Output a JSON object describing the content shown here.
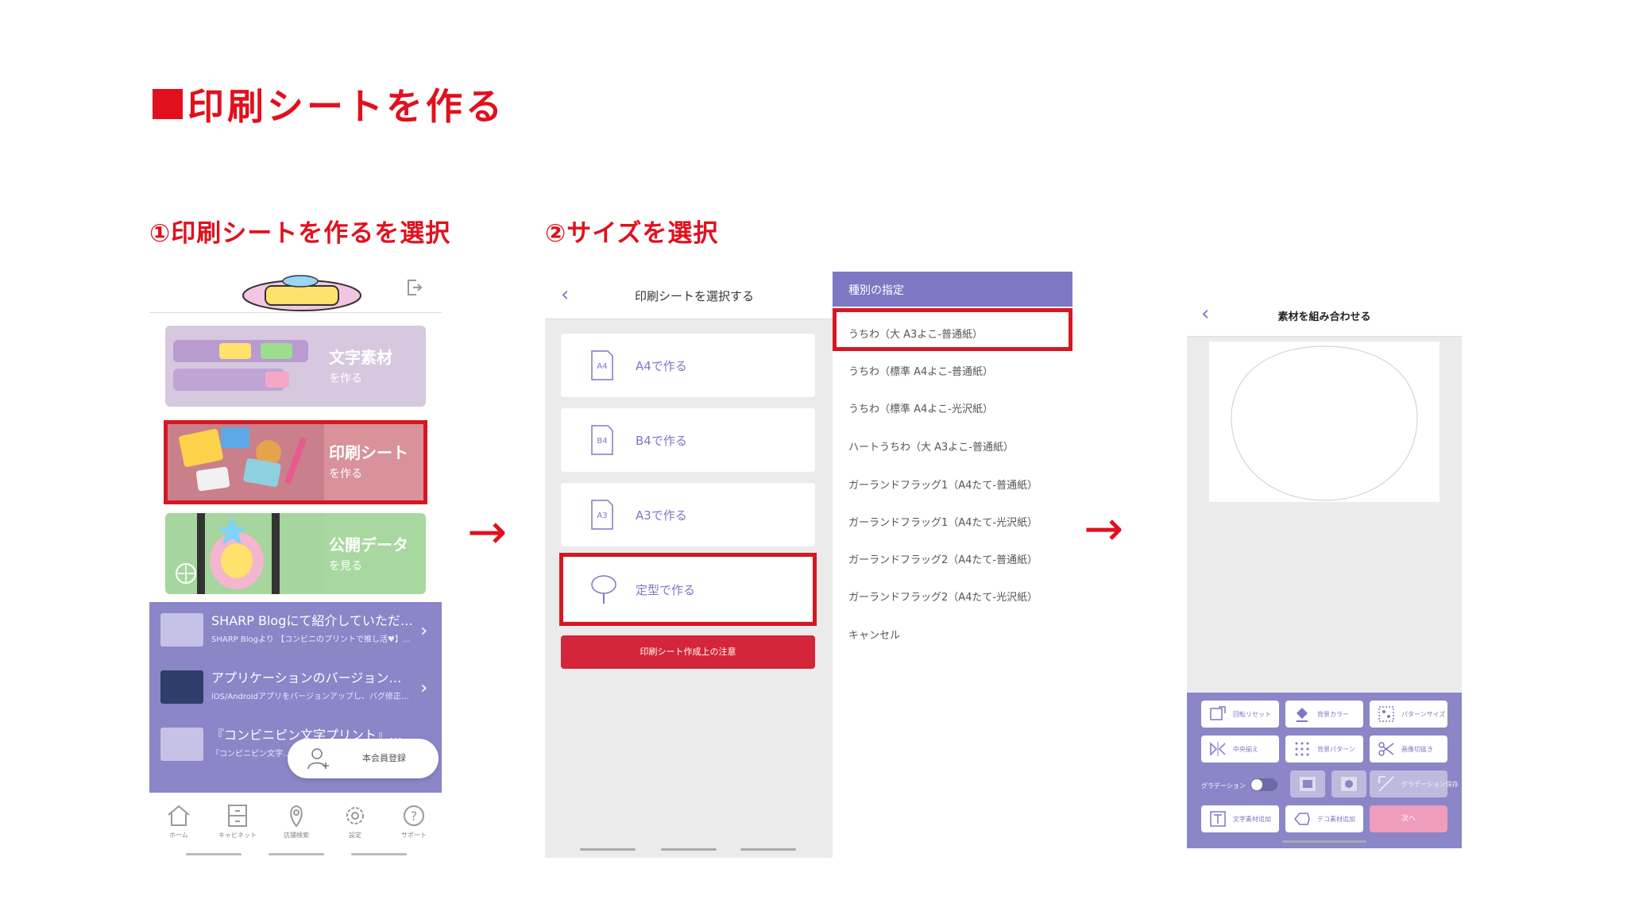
{
  "heading": "印刷シートを作る",
  "step1": "①印刷シートを作るを選択",
  "step2": "②サイズを選択",
  "arrow": "→",
  "screen1": {
    "cards": [
      {
        "title": "文字素材",
        "sub": "を作る"
      },
      {
        "title": "印刷シート",
        "sub": "を作る"
      },
      {
        "title": "公開データ",
        "sub": "を見る"
      }
    ],
    "news": [
      {
        "title": "SHARP Blogにて紹介していただ…",
        "sub": "SHARP Blogより 【コンビニのプリントで推し活♥】…"
      },
      {
        "title": "アプリケーションのバージョン…",
        "sub": "iOS/Androidアプリをバージョンアップし、バグ修正…"
      },
      {
        "title": "『コンビニピン文字プリント』…",
        "sub": "『コンビニピン文字…"
      }
    ],
    "member_button": "本会員登録",
    "tabs": [
      "ホーム",
      "キャビネット",
      "店舗検索",
      "設定",
      "サポート"
    ]
  },
  "screen2": {
    "title": "印刷シートを選択する",
    "sizes": [
      {
        "icon": "A4",
        "label": "A4で作る"
      },
      {
        "icon": "B4",
        "label": "B4で作る"
      },
      {
        "icon": "A3",
        "label": "A3で作る"
      },
      {
        "icon": "",
        "label": "定型で作る"
      }
    ],
    "notice_button": "印刷シート作成上の注意"
  },
  "dropdown": {
    "header": "種別の指定",
    "items": [
      "うちわ（大 A3よこ-普通紙）",
      "うちわ（標準 A4よこ-普通紙）",
      "うちわ（標準 A4よこ-光沢紙）",
      "ハートうちわ（大 A3よこ-普通紙）",
      "ガーランドフラッグ1（A4たて-普通紙）",
      "ガーランドフラッグ1（A4たて-光沢紙）",
      "ガーランドフラッグ2（A4たて-普通紙）",
      "ガーランドフラッグ2（A4たて-光沢紙）",
      "キャンセル"
    ]
  },
  "screen3": {
    "title": "素材を組み合わせる",
    "buttons": {
      "reset": "回転リセット",
      "bg_color": "背景カラー",
      "pattern_size": "パターンサイズ",
      "flip": "中央揃え",
      "bg_pattern": "背景パターン",
      "cut": "画像切抜き",
      "gradation_save": "グラデーション保存",
      "add_text": "文字素材追加",
      "add_deco": "デコ素材追加",
      "next": "次へ"
    },
    "gradation_label": "グラデーション"
  },
  "colors": {
    "accent_red": "#e2101d",
    "brand_purple": "#8a86c8",
    "notice_red": "#d4253a"
  }
}
